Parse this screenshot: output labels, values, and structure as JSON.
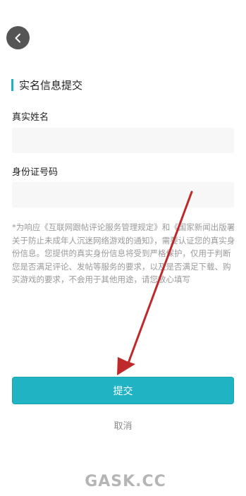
{
  "header": {
    "back_icon": "chevron-left-icon"
  },
  "form": {
    "section_title": "实名信息提交",
    "name_label": "真实姓名",
    "name_value": "",
    "id_label": "身份证号码",
    "id_value": "",
    "notice": "*为响应《互联网跟帖评论服务管理规定》和《国家新闻出版署关于防止未成年人沉迷网络游戏的通知》，需要认证您的真实身份信息。您提供的真实身份信息将受到严格保护，仅用于判断您是否满足评论、发帖等服务的要求，以及是否满足下载、购买游戏的要求，不会用于其他用途，请您放心填写",
    "submit_label": "提交",
    "cancel_label": "取消"
  },
  "watermark": {
    "text": "GASK.CC"
  },
  "colors": {
    "accent": "#1fb3c4",
    "arrow": "#c0292b"
  }
}
